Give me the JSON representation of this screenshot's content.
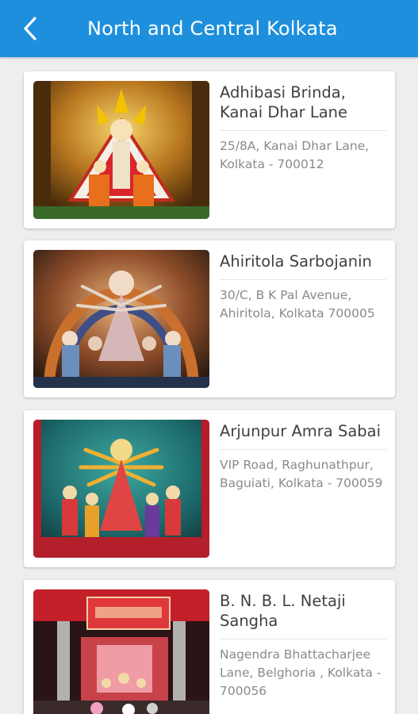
{
  "header": {
    "title": "North and Central Kolkata",
    "back_icon": "chevron-left-icon",
    "background": "#1e8fdc"
  },
  "pandals": [
    {
      "name": "Adhibasi Brinda, Kanai Dhar Lane",
      "address": "25/8A, Kanai Dhar Lane, Kolkata - 700012"
    },
    {
      "name": "Ahiritola Sarbojanin",
      "address": "30/C, B K Pal Avenue, Ahiritola, Kolkata 700005"
    },
    {
      "name": "Arjunpur Amra Sabai",
      "address": "VIP Road, Raghunathpur, Baguiati, Kolkata - 700059"
    },
    {
      "name": "B. N. B. L. Netaji Sangha",
      "address": "Nagendra Bhattacharjee Lane, Belghoria , Kolkata - 700056"
    }
  ]
}
